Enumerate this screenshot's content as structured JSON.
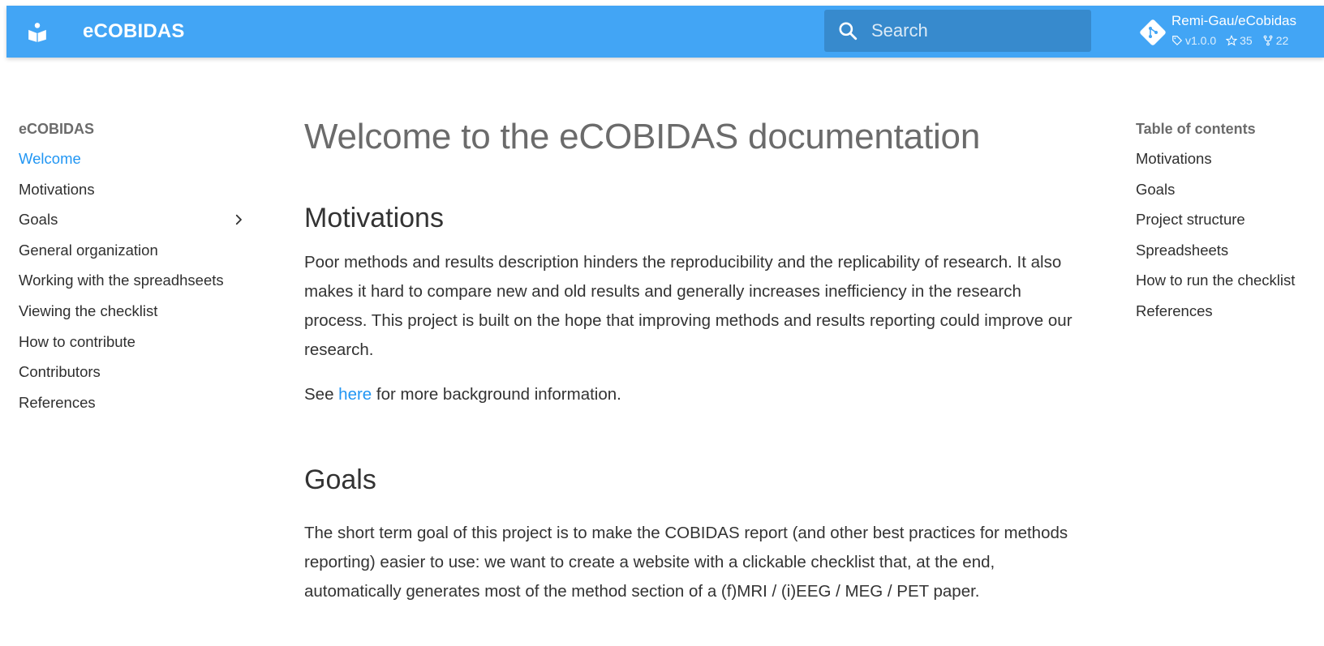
{
  "header": {
    "site_title": "eCOBIDAS",
    "logo_icon": "book-reader-icon",
    "search": {
      "placeholder": "Search",
      "icon": "search-icon"
    },
    "repo": {
      "name": "Remi-Gau/eCobidas",
      "icon": "git-icon",
      "version": "v1.0.0",
      "stars": "35",
      "forks": "22"
    },
    "colors": {
      "header_bg": "#42a5f5",
      "accent": "#2196f3"
    }
  },
  "nav": {
    "heading": "eCOBIDAS",
    "items": [
      {
        "label": "Welcome",
        "active": true
      },
      {
        "label": "Motivations"
      },
      {
        "label": "Goals",
        "expandable": true
      },
      {
        "label": "General organization"
      },
      {
        "label": "Working with the spreadhseets"
      },
      {
        "label": "Viewing the checklist"
      },
      {
        "label": "How to contribute"
      },
      {
        "label": "Contributors"
      },
      {
        "label": "References"
      }
    ]
  },
  "main": {
    "title": "Welcome to the eCOBIDAS documentation",
    "motivations": {
      "heading": "Motivations",
      "paragraph": "Poor methods and results description hinders the reproducibility and the replicability of research. It also makes it hard to compare new and old results and generally increases inefficiency in the research process. This project is built on the hope that improving methods and results reporting could improve our research.",
      "see_prefix": "See ",
      "see_link": "here",
      "see_suffix": " for more background information."
    },
    "goals": {
      "heading": "Goals",
      "paragraph": "The short term goal of this project is to make the COBIDAS report (and other best practices for methods reporting) easier to use: we want to create a website with a clickable checklist that, at the end, automatically generates most of the method section of a (f)MRI / (i)EEG / MEG / PET paper."
    }
  },
  "toc": {
    "heading": "Table of contents",
    "items": [
      {
        "label": "Motivations"
      },
      {
        "label": "Goals"
      },
      {
        "label": "Project structure"
      },
      {
        "label": "Spreadsheets"
      },
      {
        "label": "How to run the checklist"
      },
      {
        "label": "References"
      }
    ]
  }
}
